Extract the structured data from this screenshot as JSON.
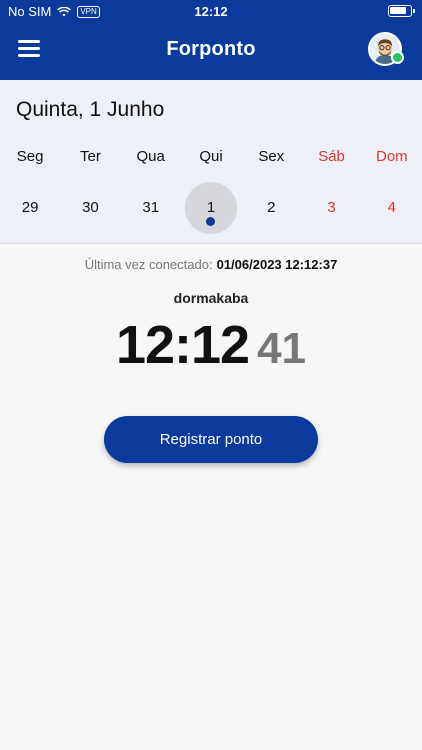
{
  "status_bar": {
    "carrier": "No SIM",
    "vpn": "VPN",
    "time": "12:12"
  },
  "app_bar": {
    "title": "Forponto",
    "menu_icon": "hamburger-menu-icon",
    "avatar_icon": "user-avatar-icon"
  },
  "calendar": {
    "current_date": "Quinta, 1 Junho",
    "weekdays": [
      {
        "label": "Seg",
        "weekend": false
      },
      {
        "label": "Ter",
        "weekend": false
      },
      {
        "label": "Qua",
        "weekend": false
      },
      {
        "label": "Qui",
        "weekend": false
      },
      {
        "label": "Sex",
        "weekend": false
      },
      {
        "label": "Sáb",
        "weekend": true
      },
      {
        "label": "Dom",
        "weekend": true
      }
    ],
    "days": [
      {
        "label": "29",
        "weekend": false,
        "selected": false
      },
      {
        "label": "30",
        "weekend": false,
        "selected": false
      },
      {
        "label": "31",
        "weekend": false,
        "selected": false
      },
      {
        "label": "1",
        "weekend": false,
        "selected": true
      },
      {
        "label": "2",
        "weekend": false,
        "selected": false
      },
      {
        "label": "3",
        "weekend": true,
        "selected": false
      },
      {
        "label": "4",
        "weekend": true,
        "selected": false
      }
    ]
  },
  "last_connection": {
    "label": "Última vez conectado:",
    "value": "01/06/2023 12:12:37"
  },
  "company": "dormakaba",
  "clock": {
    "hours_minutes": "12:12",
    "seconds": "41"
  },
  "register_button": "Registrar ponto",
  "colors": {
    "primary": "#0a3a9c",
    "weekend": "#e2372f",
    "online": "#22c55e"
  }
}
